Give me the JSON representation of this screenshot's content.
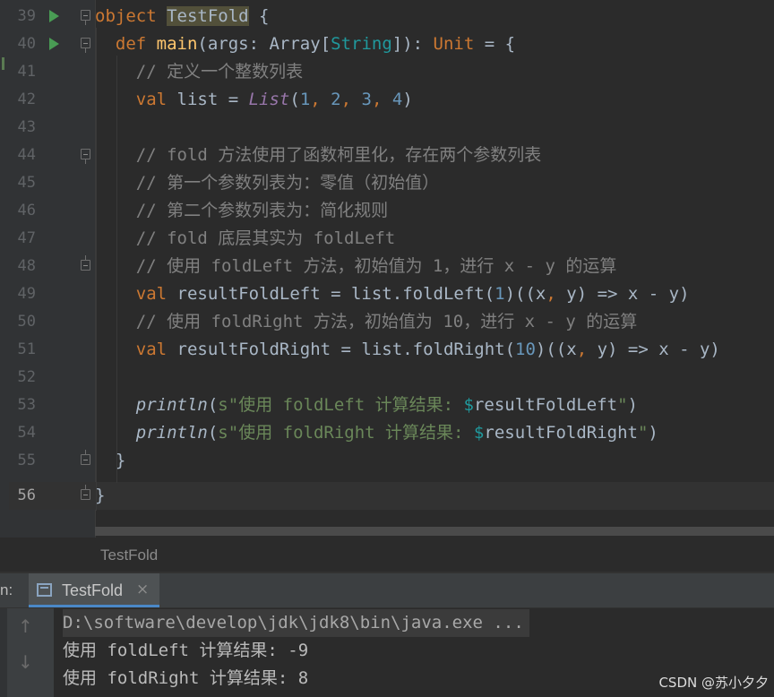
{
  "editor": {
    "line_numbers": [
      "39",
      "40",
      "41",
      "42",
      "43",
      "44",
      "45",
      "46",
      "47",
      "48",
      "49",
      "50",
      "51",
      "52",
      "53",
      "54",
      "55",
      "56"
    ],
    "lines": {
      "l39": {
        "kw": "object",
        "name": "TestFold",
        "rest": " {"
      },
      "l40": {
        "kw1": "def ",
        "fn": "main",
        "p1": "(args: Array[",
        "type": "String",
        "p2": "]): ",
        "kw2": "Unit",
        "p3": " = {"
      },
      "l41": {
        "comment": "// 定义一个整数列表"
      },
      "l42": {
        "kw": "val ",
        "t1": "list = ",
        "cls": "List",
        "t2": "(",
        "n1": "1",
        "c1": ", ",
        "n2": "2",
        "c2": ", ",
        "n3": "3",
        "c3": ", ",
        "n4": "4",
        "t3": ")"
      },
      "l44": {
        "comment": "// fold 方法使用了函数柯里化，存在两个参数列表"
      },
      "l45": {
        "comment": "// 第一个参数列表为：零值（初始值）"
      },
      "l46": {
        "comment": "// 第二个参数列表为：简化规则"
      },
      "l47": {
        "comment": "// fold 底层其实为 foldLeft"
      },
      "l48": {
        "comment": "// 使用 foldLeft 方法，初始值为 1，进行 x - y 的运算"
      },
      "l49": {
        "kw": "val ",
        "t1": "resultFoldLeft = list.foldLeft(",
        "n": "1",
        "t2": ")((x",
        "c": ",",
        "t3": " y) => x - y)"
      },
      "l50": {
        "comment": "// 使用 foldRight 方法，初始值为 10，进行 x - y 的运算"
      },
      "l51": {
        "kw": "val ",
        "t1": "resultFoldRight = list.foldRight(",
        "n": "10",
        "t2": ")((x",
        "c": ",",
        "t3": " y) => x - y)"
      },
      "l53": {
        "fn": "println",
        "t1": "(",
        "s": "s",
        "q": "\"",
        "str": "使用 foldLeft 计算结果: ",
        "var": "$",
        "t2": "resultFoldLeft",
        "q2": "\"",
        "t3": ")"
      },
      "l54": {
        "fn": "println",
        "t1": "(",
        "s": "s",
        "q": "\"",
        "str": "使用 foldRight 计算结果: ",
        "var": "$",
        "t2": "resultFoldRight",
        "q2": "\"",
        "t3": ")"
      },
      "l55": {
        "t": "}"
      },
      "l56": {
        "t": "}"
      }
    }
  },
  "breadcrumb": "TestFold",
  "run_panel": {
    "label": "n:",
    "tab_label": "TestFold",
    "close_glyph": "×",
    "up_glyph": "↑",
    "down_glyph": "↓"
  },
  "console": {
    "lines": [
      "D:\\software\\develop\\jdk\\jdk8\\bin\\java.exe ...",
      "使用 foldLeft 计算结果: -9",
      "使用 foldRight 计算结果: 8"
    ]
  },
  "watermark": "CSDN @苏小夕夕",
  "colors": {
    "background": "#2b2b2b",
    "keyword": "#cc7832",
    "function": "#ffc66d",
    "number": "#6897bb",
    "comment": "#808080",
    "string": "#6a8759",
    "run_icon": "#499c54",
    "tab_underline": "#4a88c7"
  }
}
